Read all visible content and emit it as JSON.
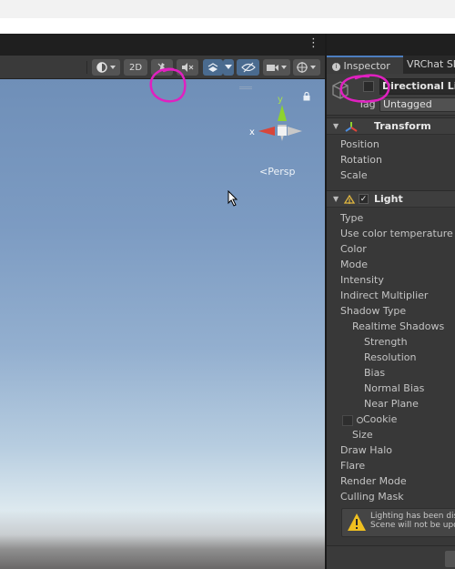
{
  "scene": {
    "toolbar": {
      "shading_icon": "shading-mode-icon",
      "mode_2d_label": "2D",
      "lighting_icon": "lighting-toggle-icon",
      "audio_icon": "audio-mute-icon",
      "effects_icon": "effects-icon",
      "hidden_icon": "scene-visibility-icon",
      "camera_icon": "scene-camera-icon",
      "gizmos_icon": "gizmos-icon"
    },
    "gizmo": {
      "x_label": "x",
      "y_label": "y",
      "z_label": "z"
    },
    "persp_label": "Persp"
  },
  "inspector": {
    "tabs": [
      {
        "label": "Inspector"
      },
      {
        "label": "VRChat SD"
      }
    ],
    "object": {
      "name": "Directional Ligh",
      "tag_label": "Tag",
      "tag_value": "Untagged"
    },
    "transform": {
      "title": "Transform",
      "properties": [
        "Position",
        "Rotation",
        "Scale"
      ]
    },
    "light": {
      "title": "Light",
      "properties": [
        "Type",
        "Use color temperature mo",
        "Color",
        "Mode",
        "Intensity",
        "Indirect Multiplier",
        "Shadow Type",
        "Realtime Shadows",
        "Strength",
        "Resolution",
        "Bias",
        "Normal Bias",
        "Near Plane",
        "Cookie",
        "Size",
        "Draw Halo",
        "Flare",
        "Render Mode",
        "Culling Mask"
      ]
    },
    "warning": {
      "line1": "Lighting has been disab",
      "line2": "Scene will not be updat"
    }
  },
  "colors": {
    "annotation": "#e020c0",
    "toolbar_active": "#4a6b8f",
    "tab_accent": "#4d7ec0"
  }
}
